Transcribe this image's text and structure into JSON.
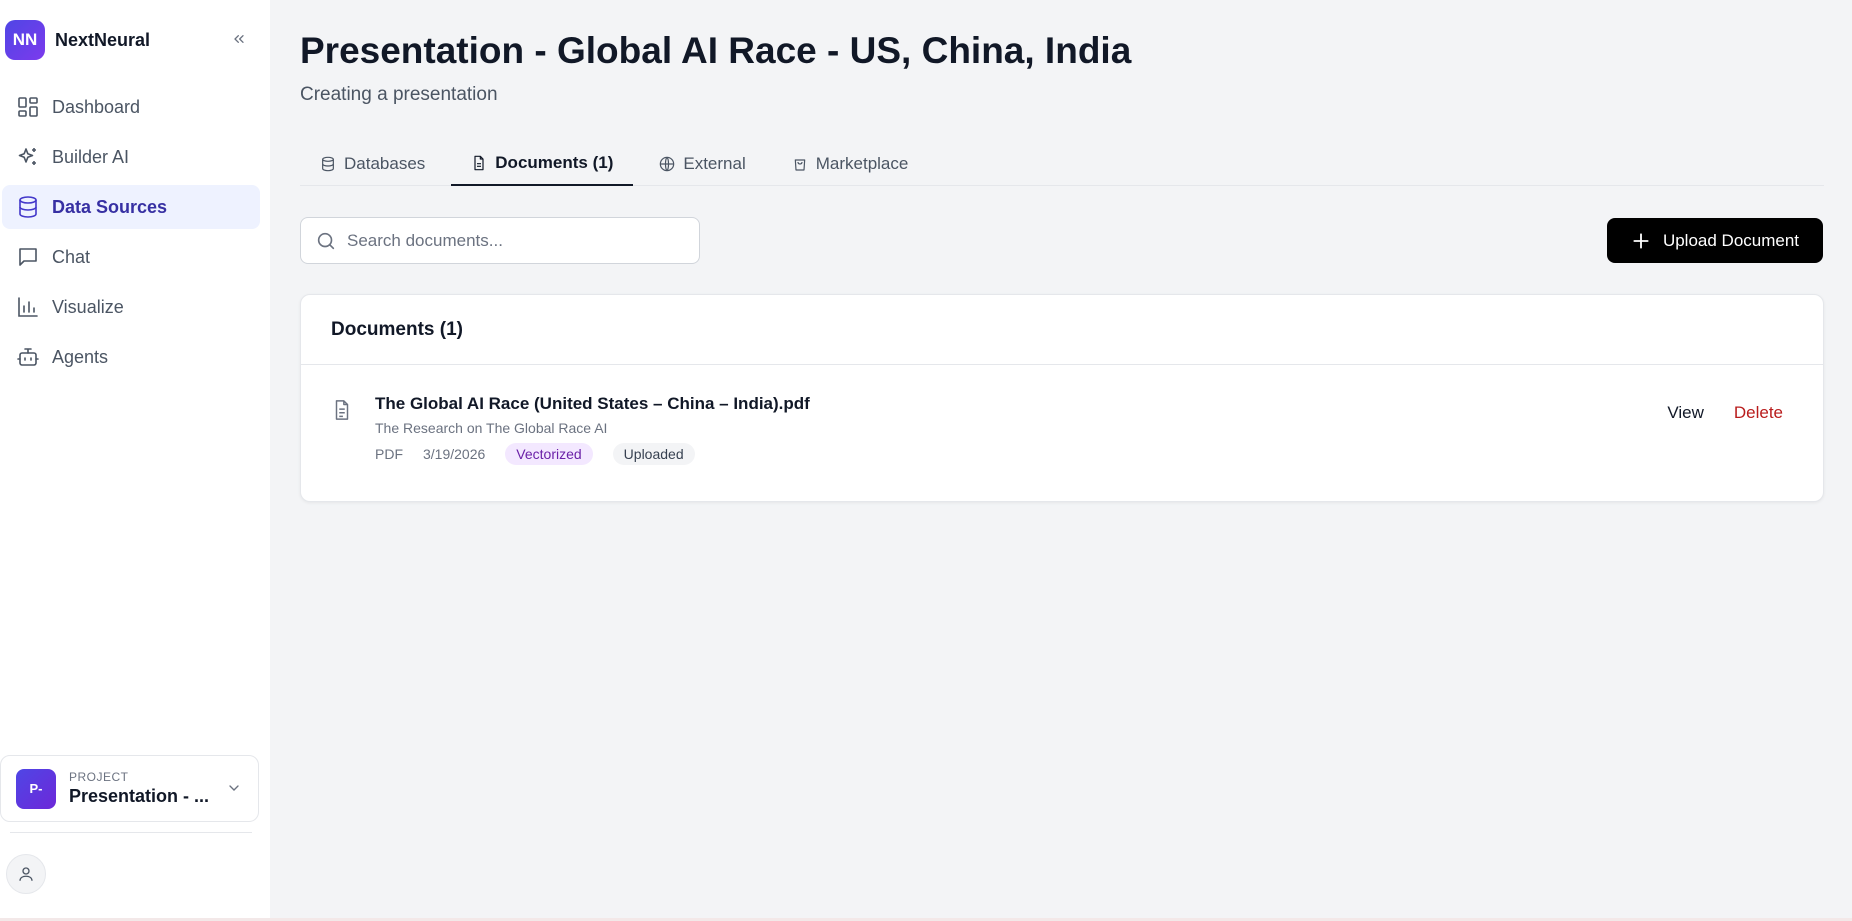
{
  "brand": {
    "logo_text": "NN",
    "name": "NextNeural"
  },
  "sidebar": {
    "items": [
      {
        "label": "Dashboard",
        "icon": "dashboard-icon"
      },
      {
        "label": "Builder AI",
        "icon": "sparkles-icon"
      },
      {
        "label": "Data Sources",
        "icon": "database-icon",
        "active": true
      },
      {
        "label": "Chat",
        "icon": "chat-icon"
      },
      {
        "label": "Visualize",
        "icon": "bar-chart-icon"
      },
      {
        "label": "Agents",
        "icon": "bot-icon"
      }
    ],
    "project": {
      "avatar": "P-",
      "kicker": "PROJECT",
      "name": "Presentation - ..."
    }
  },
  "header": {
    "title": "Presentation - Global AI Race - US, China, India",
    "subtitle": "Creating a presentation"
  },
  "tabs": [
    {
      "label": "Databases",
      "icon": "database-icon"
    },
    {
      "label": "Documents (1)",
      "icon": "file-icon",
      "active": true
    },
    {
      "label": "External",
      "icon": "globe-icon"
    },
    {
      "label": "Marketplace",
      "icon": "shopping-bag-icon"
    }
  ],
  "search": {
    "placeholder": "Search documents...",
    "value": ""
  },
  "upload_button": {
    "label": "Upload Document"
  },
  "documents": {
    "header": "Documents (1)",
    "items": [
      {
        "title": "The Global AI Race (United States – China – India).pdf",
        "description": "The Research on The Global Race AI",
        "type": "PDF",
        "date": "3/19/2026",
        "badges": [
          "Vectorized",
          "Uploaded"
        ],
        "actions": {
          "view": "View",
          "delete": "Delete"
        }
      }
    ]
  },
  "colors": {
    "accent": "#4f46e5",
    "active_bg": "#eef2ff",
    "delete": "#b91c1c",
    "vectorized_bg": "#f3e8ff"
  }
}
